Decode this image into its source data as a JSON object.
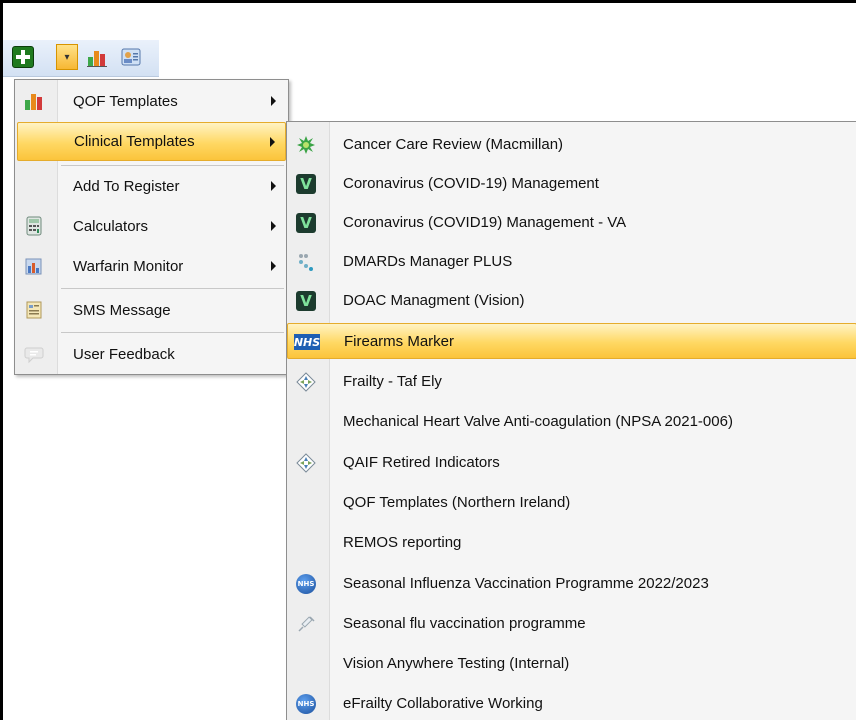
{
  "toolbar": {
    "buttons": [
      {
        "icon": "add-icon"
      },
      {
        "icon": "dropdown-arrow-icon"
      },
      {
        "icon": "bar-chart-icon"
      },
      {
        "icon": "contact-card-icon"
      }
    ]
  },
  "menu": {
    "items": [
      {
        "label": "QOF Templates",
        "icon": "bar-chart-icon",
        "has_submenu": true
      },
      {
        "label": "Clinical Templates",
        "icon": "",
        "has_submenu": true,
        "highlighted": true
      },
      {
        "label": "Add To Register",
        "icon": "",
        "has_submenu": true
      },
      {
        "label": "Calculators",
        "icon": "calculator-icon",
        "has_submenu": true
      },
      {
        "label": "Warfarin Monitor",
        "icon": "warfarin-monitor-icon",
        "has_submenu": true
      },
      {
        "label": "SMS Message",
        "icon": "sms-icon",
        "has_submenu": false
      },
      {
        "label": "User Feedback",
        "icon": "feedback-icon",
        "has_submenu": false
      }
    ]
  },
  "submenu": {
    "items": [
      {
        "label": "Cancer Care Review (Macmillan)",
        "icon": "macmillan-icon"
      },
      {
        "label": "Coronavirus (COVID-19) Management",
        "icon": "vision-v-icon"
      },
      {
        "label": "Coronavirus (COVID19) Management - VA",
        "icon": "vision-v-icon"
      },
      {
        "label": "DMARDs Manager PLUS",
        "icon": "dots-icon"
      },
      {
        "label": "DOAC Managment (Vision)",
        "icon": "vision-v-icon"
      },
      {
        "label": "Firearms Marker",
        "icon": "nhs-logo-icon",
        "highlighted": true
      },
      {
        "label": "Frailty - Taf Ely",
        "icon": "diamond-arrows-icon"
      },
      {
        "label": "Mechanical Heart Valve Anti-coagulation (NPSA 2021-006)",
        "icon": ""
      },
      {
        "label": "QAIF Retired Indicators",
        "icon": "diamond-arrows-icon"
      },
      {
        "label": "QOF Templates (Northern Ireland)",
        "icon": ""
      },
      {
        "label": "REMOS reporting",
        "icon": ""
      },
      {
        "label": "Seasonal Influenza Vaccination Programme 2022/2023",
        "icon": "nhs-circle-icon"
      },
      {
        "label": "Seasonal flu vaccination programme",
        "icon": "syringe-icon"
      },
      {
        "label": "Vision Anywhere Testing (Internal)",
        "icon": ""
      },
      {
        "label": "eFrailty Collaborative Working",
        "icon": "nhs-circle-icon"
      }
    ]
  },
  "icon_text": {
    "vision": "V",
    "nhs": "NHS"
  },
  "colors": {
    "highlight_top": "#fff3c4",
    "highlight_bottom": "#fbc43b",
    "highlight_border": "#e5ac2c",
    "menu_bg": "#f5f5f5",
    "toolbar_bg": "#d3e1f3"
  }
}
